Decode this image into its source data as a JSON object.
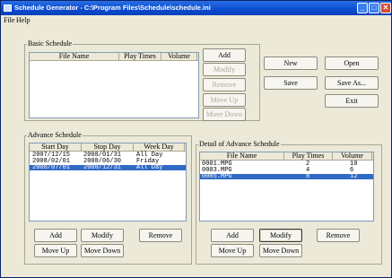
{
  "titlebar": {
    "title": "Schedule Generator - C:\\Program Files\\Schedule\\schedule.ini",
    "minimize": "_",
    "maximize": "□",
    "close": "✕"
  },
  "menu": {
    "file": "File",
    "help": "Help"
  },
  "basic": {
    "legend": "Basic Schedule",
    "columns": [
      "File Name",
      "Play Times",
      "Volume"
    ],
    "add": "Add",
    "modify": "Modify",
    "remove": "Remove",
    "move_up": "Move Up",
    "move_down": "Move Down"
  },
  "file_buttons": {
    "new": "New",
    "open": "Open",
    "save": "Save",
    "save_as": "Save As...",
    "exit": "Exit"
  },
  "advance": {
    "legend": "Advance Schedule",
    "columns": [
      "Start Day",
      "Stop Day",
      "Week Day"
    ],
    "rows": [
      {
        "start": "2007/12/15",
        "stop": "2008/01/31",
        "week": "All Day"
      },
      {
        "start": "2008/02/01",
        "stop": "2008/06/30",
        "week": "Friday"
      },
      {
        "start": "2008/07/01",
        "stop": "2008/12/31",
        "week": "All Day"
      }
    ],
    "add": "Add",
    "modify": "Modify",
    "remove": "Remove",
    "move_up": "Move Up",
    "move_down": "Move Down"
  },
  "detail": {
    "legend": "Detail of Advance Schedule",
    "columns": [
      "File Name",
      "Play Times",
      "Volume"
    ],
    "rows": [
      {
        "file": "0001.MPG",
        "plays": "2",
        "volume": "10"
      },
      {
        "file": "0003.MPG",
        "plays": "4",
        "volume": "6"
      },
      {
        "file": "0005.MPG",
        "plays": "8",
        "volume": "12"
      }
    ],
    "add": "Add",
    "modify": "Modify",
    "remove": "Remove",
    "move_up": "Move Up",
    "move_down": "Move Down"
  }
}
